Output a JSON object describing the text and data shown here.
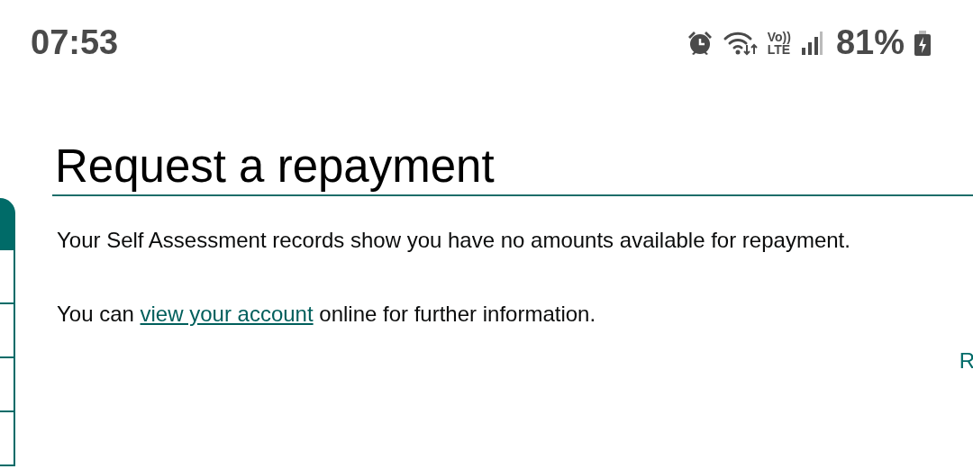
{
  "status_bar": {
    "time": "07:53",
    "volte": {
      "top": "Vo))",
      "bottom": "LTE"
    },
    "battery": "81%"
  },
  "page": {
    "title": "Request a repayment",
    "paragraphs": [
      {
        "kind": "text",
        "text": "Your Self Assessment records show you have no amounts available for repayment."
      },
      {
        "kind": "link",
        "before": "You can ",
        "link": "view your account",
        "after": " online for further information."
      }
    ],
    "cut_link": "R"
  },
  "side_menu": {
    "items": [
      {
        "kind": "header"
      },
      {
        "kind": "item"
      },
      {
        "kind": "item"
      },
      {
        "kind": "item"
      },
      {
        "kind": "item"
      }
    ]
  }
}
